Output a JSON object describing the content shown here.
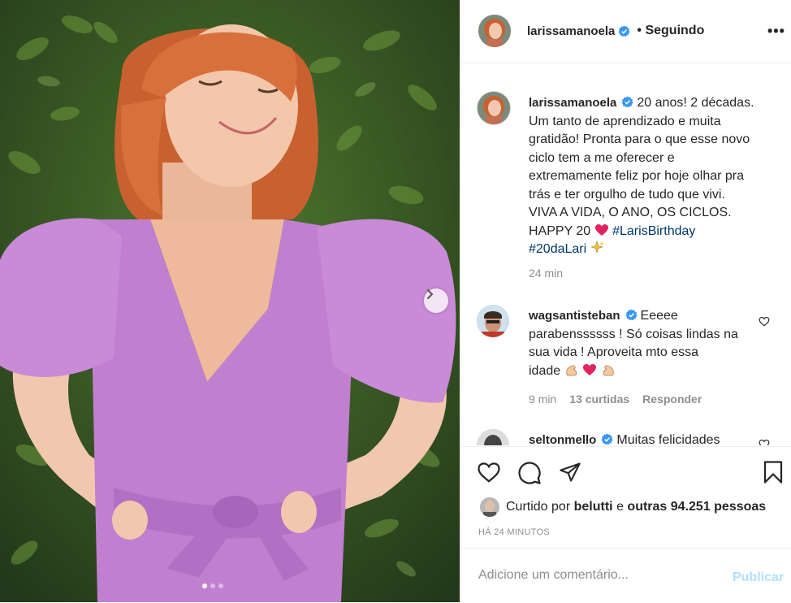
{
  "post": {
    "username": "larissamanoela",
    "follow_status": "• Seguindo",
    "more_label": "•••",
    "caption_lines": [
      "20 anos! 2 décadas.",
      "Um tanto de aprendizado e muita",
      "gratidão! Pronta para o que esse novo",
      "ciclo tem a me oferecer e",
      "extremamente feliz por hoje olhar pra",
      "trás e ter orgulho de tudo que vivi.",
      "VIVA A VIDA, O ANO, OS CICLOS.",
      "HAPPY 20"
    ],
    "hashtag_1": "#LarisBirthday",
    "hashtag_2": "#20daLari",
    "caption_time": "24 min"
  },
  "comments": [
    {
      "username": "wagsantisteban",
      "text_line1": "Eeeee",
      "text_line2": "parabenssssss ! Só coisas lindas na",
      "text_line3": "sua vida ! Aproveita mto essa",
      "text_line4": "idade",
      "time": "9 min",
      "likes": "13 curtidas",
      "reply": "Responder"
    },
    {
      "username": "seltonmello",
      "text": "Muitas felicidades"
    }
  ],
  "likes": {
    "prefix": "Curtido por",
    "user": "belutti",
    "joiner": "e",
    "others": "outras 94.251 pessoas"
  },
  "time_ago": "HÁ 24 MINUTOS",
  "add_comment": {
    "placeholder": "Adicione um comentário...",
    "publish": "Publicar"
  },
  "carousel": {
    "count": 3,
    "active": 0
  },
  "colors": {
    "accent": "#0095f6",
    "verified": "#3897f0",
    "dress": "#c17fd0",
    "hair": "#d8703b"
  }
}
